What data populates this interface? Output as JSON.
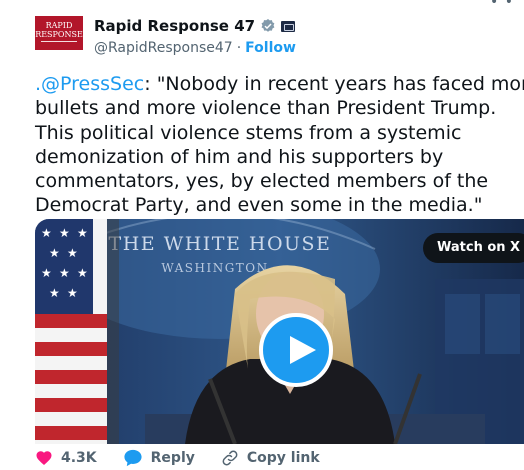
{
  "author": {
    "display_name": "Rapid Response 47",
    "handle": "@RapidResponse47",
    "separator": "·",
    "follow_label": "Follow",
    "avatar_text": "RAPID RESPONSE"
  },
  "tweet": {
    "lines": [
      {
        "mention": ".@PressSec",
        "text": ": \"Nobody in recent years has faced more"
      },
      {
        "mention": "",
        "text": "bullets and more violence than President Trump."
      },
      {
        "mention": "",
        "text": "This political violence stems from a systemic"
      },
      {
        "mention": "",
        "text": "demonization of him and his supporters by"
      },
      {
        "mention": "",
        "text": "commentators, yes, by elected members of the"
      },
      {
        "mention": "",
        "text": "Democrat Party, and even some in the media.\""
      }
    ]
  },
  "media": {
    "backdrop_text_line1": "THE WHITE HOUSE",
    "backdrop_text_line2": "WASHINGTON",
    "watch_on_label": "Watch on X"
  },
  "actions": {
    "like_count": "4.3K",
    "reply_label": "Reply",
    "copy_label": "Copy link"
  },
  "colors": {
    "accent": "#1d9bf0",
    "text": "#0f1419",
    "muted": "#536471",
    "like": "#f91880",
    "avatar_bg": "#b2162a"
  },
  "icons": [
    "verified-badge-icon",
    "government-badge-icon",
    "more-icon",
    "play-icon",
    "heart-icon",
    "reply-bubble-icon",
    "link-icon"
  ]
}
